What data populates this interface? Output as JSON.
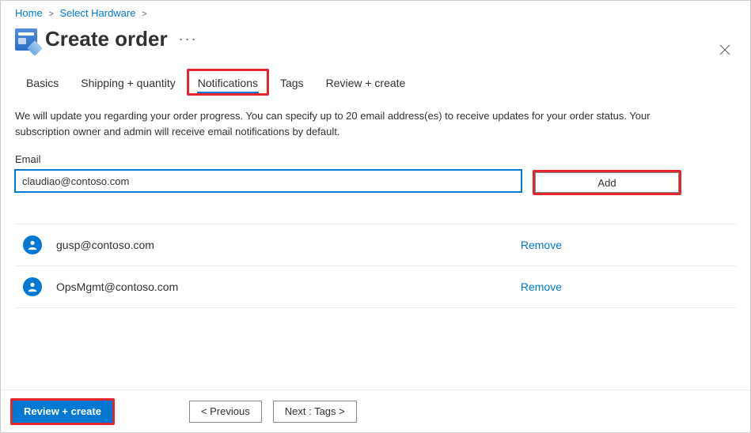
{
  "breadcrumb": {
    "home": "Home",
    "select_hardware": "Select Hardware"
  },
  "page_title": "Create order",
  "tabs": {
    "basics": "Basics",
    "shipping": "Shipping + quantity",
    "notifications": "Notifications",
    "tags": "Tags",
    "review": "Review + create"
  },
  "description": "We will update you regarding your order progress. You can specify up to 20 email address(es) to receive updates for your order status. Your subscription owner and admin will receive email notifications by default.",
  "email_field": {
    "label": "Email",
    "value": "claudiao@contoso.com",
    "add_button": "Add"
  },
  "emails": [
    {
      "address": "gusp@contoso.com",
      "remove": "Remove"
    },
    {
      "address": "OpsMgmt@contoso.com",
      "remove": "Remove"
    }
  ],
  "footer": {
    "review_create": "Review + create",
    "previous": "<  Previous",
    "next": "Next : Tags  >"
  }
}
